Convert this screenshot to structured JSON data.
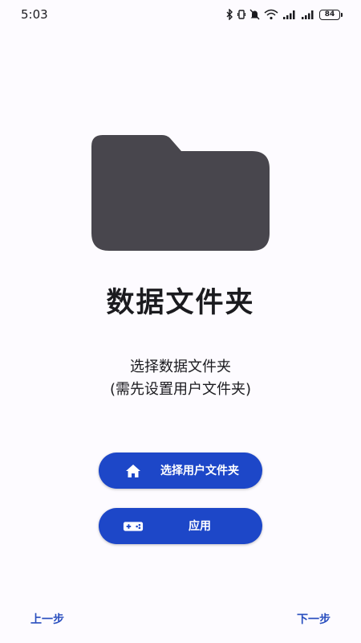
{
  "status_bar": {
    "time": "5:03",
    "battery_level": "84",
    "icons": [
      "bluetooth-icon",
      "vibrate-icon",
      "mute-icon",
      "wifi-icon",
      "signal-icon",
      "signal-icon",
      "battery-icon"
    ]
  },
  "main": {
    "illustration_icon": "folder-icon",
    "illustration_color": "#48464d",
    "title": "数据文件夹",
    "description_line1": "选择数据文件夹",
    "description_line2": "(需先设置用户文件夹)"
  },
  "buttons": {
    "select_user_folder": {
      "icon": "home-icon",
      "label": "选择用户文件夹"
    },
    "apply": {
      "icon": "gamepad-icon",
      "label": "应用"
    },
    "color": "#1d47c8"
  },
  "navigation": {
    "prev_label": "上一步",
    "next_label": "下一步",
    "link_color": "#2a4fbf"
  }
}
